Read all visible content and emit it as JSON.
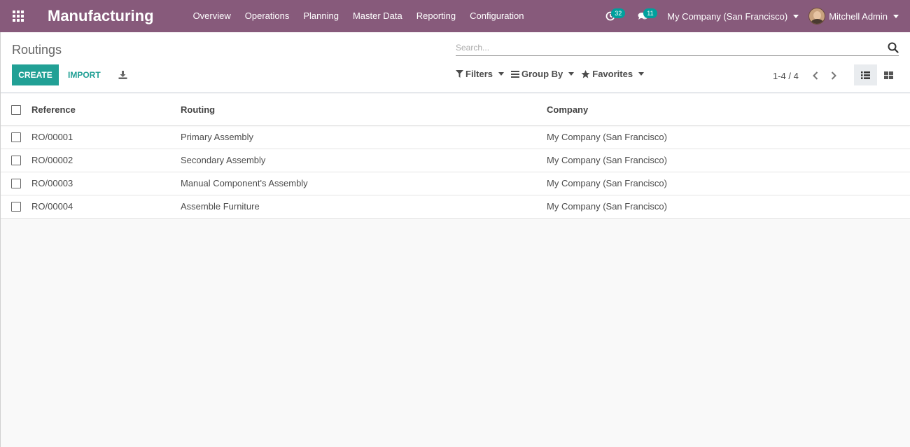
{
  "app": {
    "title": "Manufacturing"
  },
  "menu": [
    {
      "label": "Overview"
    },
    {
      "label": "Operations"
    },
    {
      "label": "Planning"
    },
    {
      "label": "Master Data"
    },
    {
      "label": "Reporting"
    },
    {
      "label": "Configuration"
    }
  ],
  "systray": {
    "activity_count": "32",
    "message_count": "11",
    "company": "My Company (San Francisco)",
    "user": "Mitchell Admin"
  },
  "control_panel": {
    "breadcrumb": "Routings",
    "create_label": "CREATE",
    "import_label": "IMPORT",
    "search_placeholder": "Search...",
    "filters_label": "Filters",
    "groupby_label": "Group By",
    "favorites_label": "Favorites",
    "pager_value": "1-4 / 4"
  },
  "table": {
    "headers": {
      "reference": "Reference",
      "routing": "Routing",
      "company": "Company"
    },
    "rows": [
      {
        "reference": "RO/00001",
        "routing": "Primary Assembly",
        "company": "My Company (San Francisco)"
      },
      {
        "reference": "RO/00002",
        "routing": "Secondary Assembly",
        "company": "My Company (San Francisco)"
      },
      {
        "reference": "RO/00003",
        "routing": "Manual Component's Assembly",
        "company": "My Company (San Francisco)"
      },
      {
        "reference": "RO/00004",
        "routing": "Assemble Furniture",
        "company": "My Company (San Francisco)"
      }
    ]
  },
  "colors": {
    "navbar": "#875a7b",
    "primary_button": "#21a095",
    "badge": "#00a09d"
  },
  "icons": {
    "apps": "apps-grid-icon",
    "activity": "clock-icon",
    "messages": "comments-icon",
    "download": "download-icon",
    "search": "search-icon",
    "filters": "filter-icon",
    "groupby": "bars-icon",
    "favorites": "star-icon",
    "pager_prev": "chevron-left-icon",
    "pager_next": "chevron-right-icon",
    "list_view": "list-view-icon",
    "kanban_view": "kanban-view-icon"
  }
}
